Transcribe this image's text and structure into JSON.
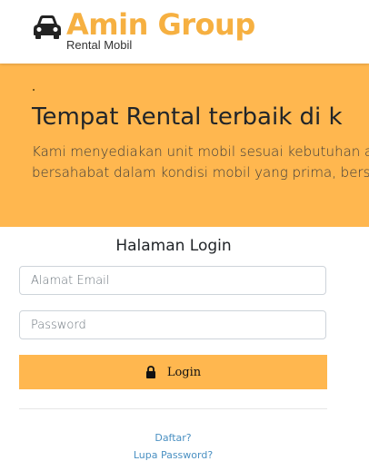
{
  "header": {
    "brand_title": "Amin Group",
    "brand_subtitle": "Rental Mobil",
    "logo_icon": "car-icon",
    "brand_color": "#f6b041"
  },
  "hero": {
    "title": "Tempat Rental terbaik di k",
    "lines": [
      "Kami menyediakan unit mobil sesuai kebutuhan ar",
      "bersahabat dalam kondisi mobil yang prima, bersih"
    ],
    "background": "#ffb74f"
  },
  "login": {
    "title": "Halaman Login",
    "email_placeholder": "Alamat Email",
    "password_placeholder": "Password",
    "button_label": "Login",
    "button_icon": "lock-icon",
    "register_link": "Daftar?",
    "forgot_link": "Lupa Password?"
  }
}
